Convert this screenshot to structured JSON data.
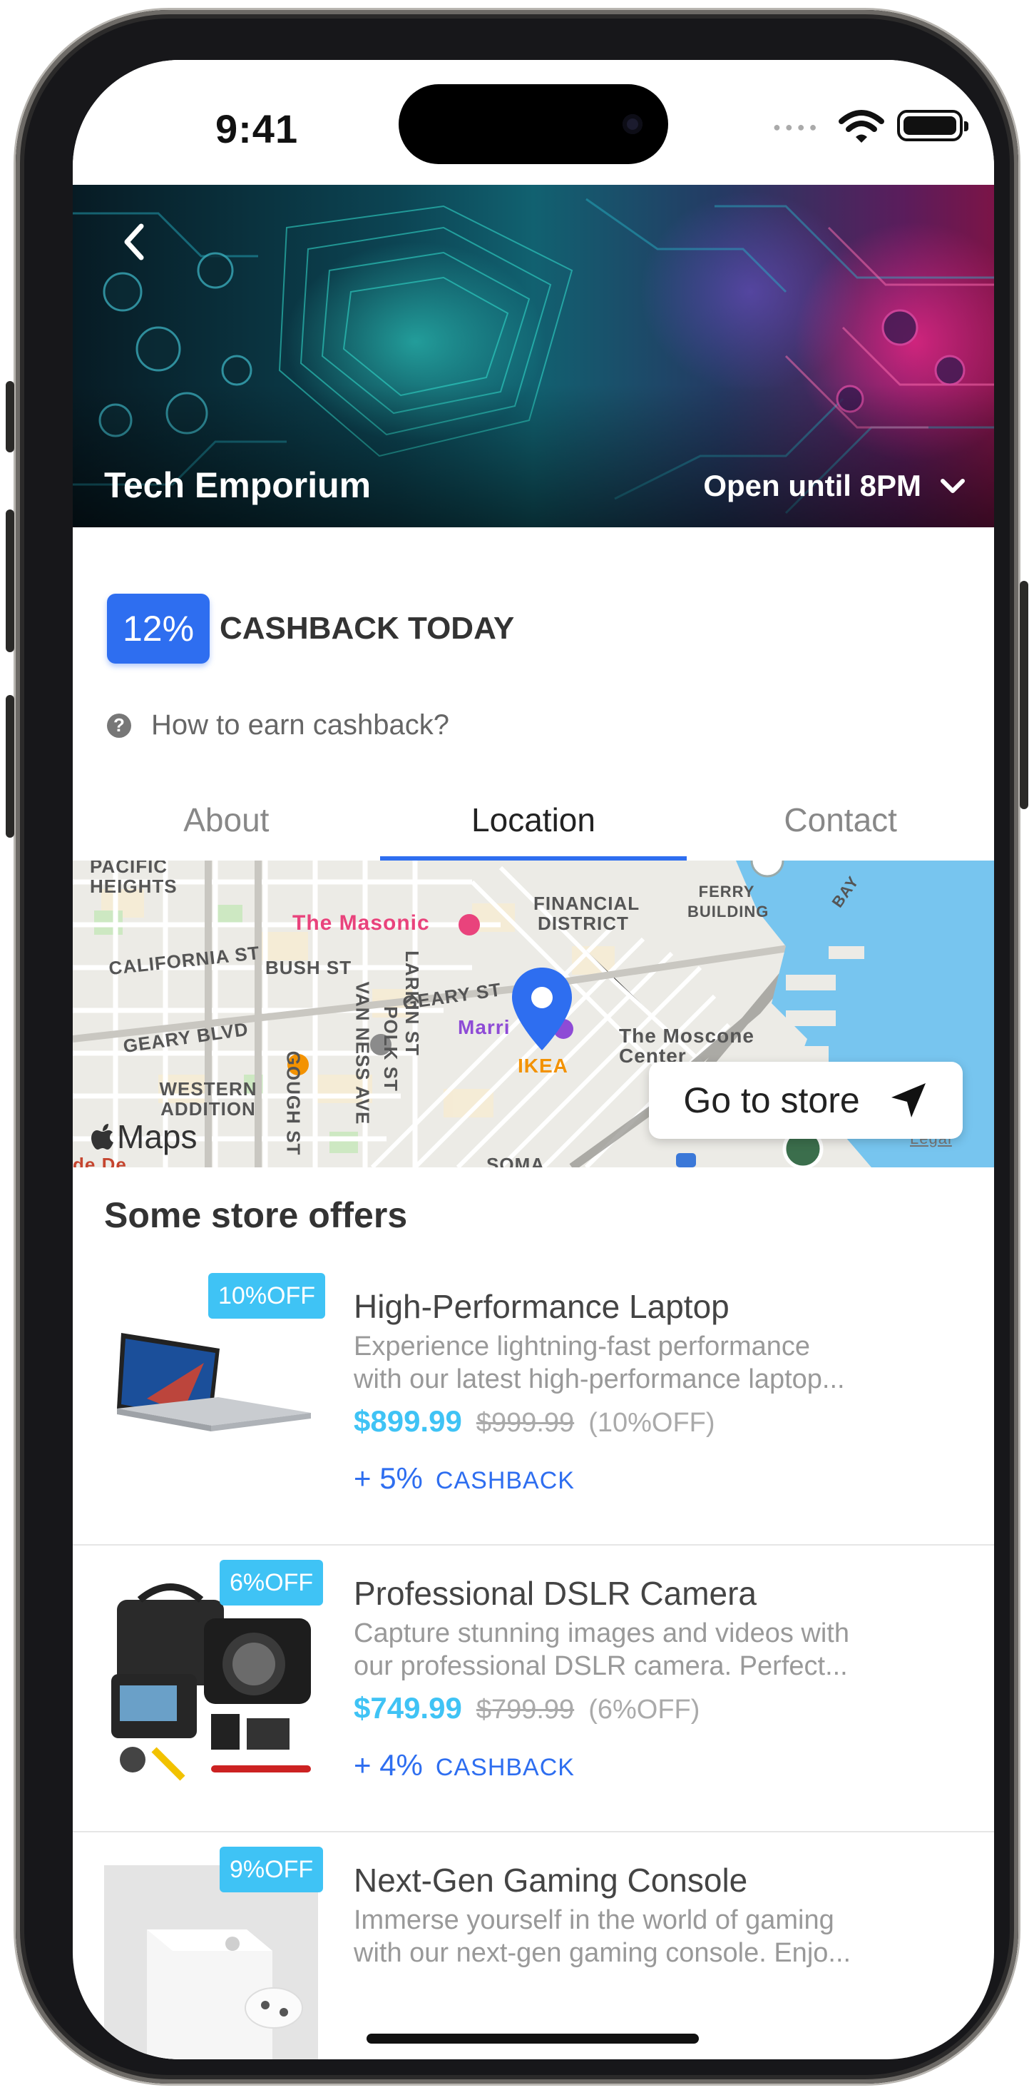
{
  "status_bar": {
    "time": "9:41"
  },
  "header": {
    "store_name": "Tech Emporium",
    "hours": "Open until 8PM"
  },
  "cashback": {
    "percent": "12%",
    "label": "CASHBACK TODAY",
    "help_text": "How to earn cashback?"
  },
  "tabs": [
    {
      "label": "About",
      "active": false
    },
    {
      "label": "Location",
      "active": true
    },
    {
      "label": "Contact",
      "active": false
    }
  ],
  "map": {
    "labels": {
      "pacific_heights": "PACIFIC HEIGHTS",
      "financial_district": "FINANCIAL DISTRICT",
      "ferry_building": "FERRY BUILDING",
      "bay": "BAY",
      "masonic": "The Masonic",
      "california": "CALIFORNIA ST",
      "bush": "BUSH ST",
      "larkin": "LARKIN ST",
      "polk": "POLK ST",
      "van_ness": "VAN NESS AVE",
      "geary_st": "GEARY ST",
      "geary_blvd": "GEARY BLVD",
      "gough": "GOUGH ST",
      "western_addition": "WESTERN ADDITION",
      "marriott": "Marri",
      "ikea": "IKEA",
      "moscone": "The Moscone Center",
      "soma": "SOMA",
      "de_de": "de De",
      "legal": "Legal"
    },
    "maps_logo": "Maps",
    "go_to_store": "Go to store"
  },
  "offers_section": {
    "title": "Some store offers",
    "items": [
      {
        "badge": "10%OFF",
        "title": "High-Performance Laptop",
        "desc_line1": "Experience lightning-fast performance",
        "desc_line2": "with our latest high-performance laptop...",
        "price": "$899.99",
        "old_price": "$999.99",
        "discount": "(10%OFF)",
        "cashback": "+ 5%",
        "cashback_label": "CASHBACK"
      },
      {
        "badge": "6%OFF",
        "title": "Professional DSLR Camera",
        "desc_line1": "Capture stunning images and videos with",
        "desc_line2": "our professional DSLR camera. Perfect...",
        "price": "$749.99",
        "old_price": "$799.99",
        "discount": "(6%OFF)",
        "cashback": "+ 4%",
        "cashback_label": "CASHBACK"
      },
      {
        "badge": "9%OFF",
        "title": "Next-Gen Gaming Console",
        "desc_line1": "Immerse yourself in the world of gaming",
        "desc_line2": "with our next-gen gaming console. Enjo..."
      }
    ]
  },
  "colors": {
    "accent": "#2e6ef0",
    "price": "#3fc3f5",
    "badge": "#3fc3f5"
  }
}
